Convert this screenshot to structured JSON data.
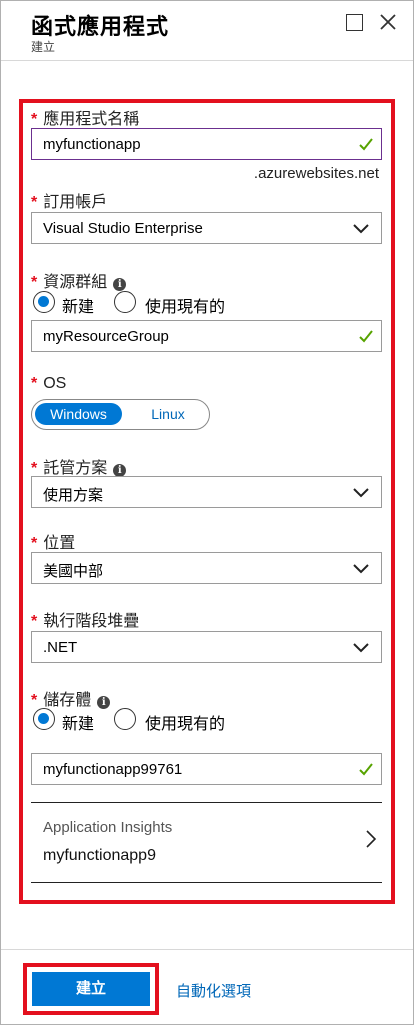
{
  "header": {
    "title": "函式應用程式",
    "subtitle": "建立"
  },
  "form": {
    "app_name": {
      "label": "應用程式名稱",
      "value": "myfunctionapp",
      "suffix": ".azurewebsites.net"
    },
    "subscription": {
      "label": "訂用帳戶",
      "value": "Visual Studio Enterprise"
    },
    "resource_group": {
      "label": "資源群組",
      "option_new": "新建",
      "option_existing": "使用現有的",
      "selected": "new",
      "value": "myResourceGroup"
    },
    "os": {
      "label": "OS",
      "options": [
        "Windows",
        "Linux"
      ],
      "selected": "Windows"
    },
    "hosting_plan": {
      "label": "託管方案",
      "value": "使用方案"
    },
    "location": {
      "label": "位置",
      "value": "美國中部"
    },
    "runtime_stack": {
      "label": "執行階段堆疊",
      "value": ".NET"
    },
    "storage": {
      "label": "儲存體",
      "option_new": "新建",
      "option_existing": "使用現有的",
      "selected": "new",
      "value": "myfunctionapp99761"
    },
    "app_insights": {
      "title": "Application Insights",
      "value": "myfunctionapp9"
    }
  },
  "footer": {
    "create_label": "建立",
    "automation_label": "自動化選項"
  },
  "colors": {
    "accent": "#0078d4",
    "highlight": "#e3101e",
    "valid_check": "#57a300"
  }
}
